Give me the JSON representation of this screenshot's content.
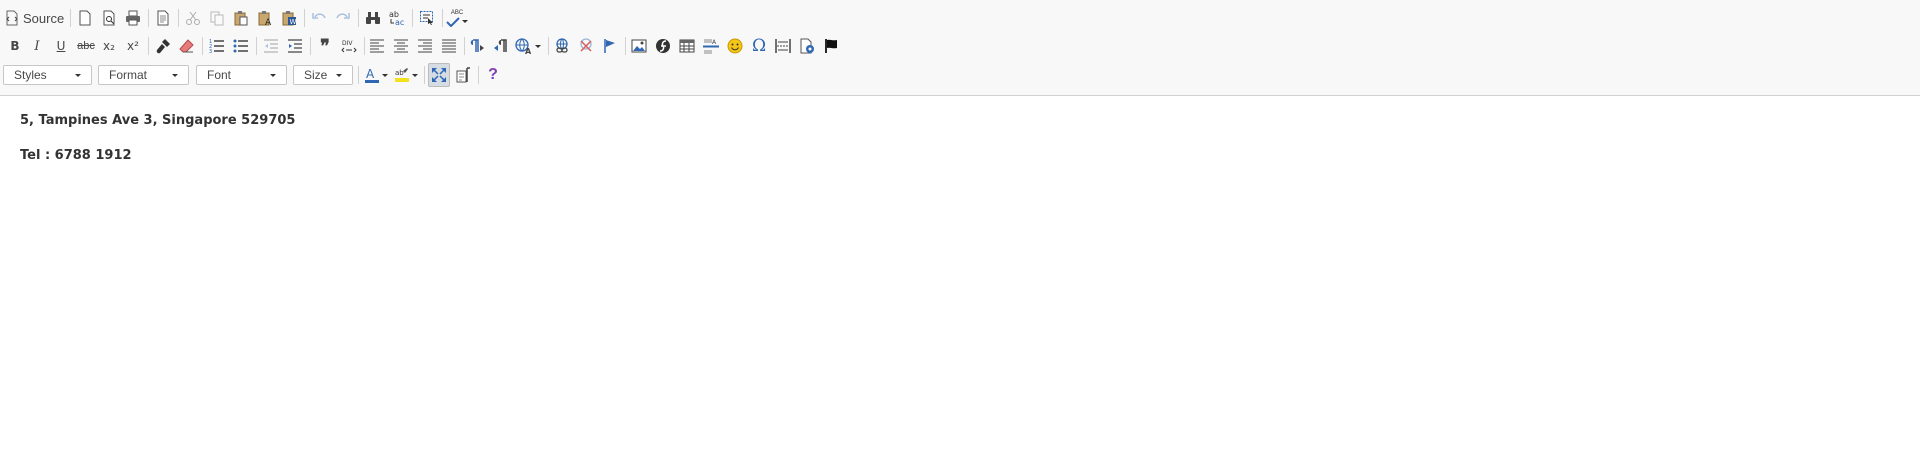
{
  "toolbar": {
    "source_label": "Source",
    "styles_label": "Styles",
    "format_label": "Format",
    "font_label": "Font",
    "size_label": "Size",
    "spellcheck_label": "ABC",
    "bold_label": "B",
    "italic_label": "I",
    "underline_label": "U",
    "strike_label": "abc",
    "subscript_label": "x₂",
    "superscript_label": "x²",
    "blockquote_label": "❞",
    "special_char_label": "Ω",
    "help_label": "?"
  },
  "colors": {
    "icon_gray": "#474747",
    "icon_blue": "#2f67b2",
    "active_bg": "#d6dce4",
    "toolbar_bg": "#f8f8f8",
    "border": "#d1d1d1"
  },
  "content": {
    "line1": "5, Tampines Ave 3, Singapore 529705",
    "line2": "Tel : 6788 1912"
  }
}
